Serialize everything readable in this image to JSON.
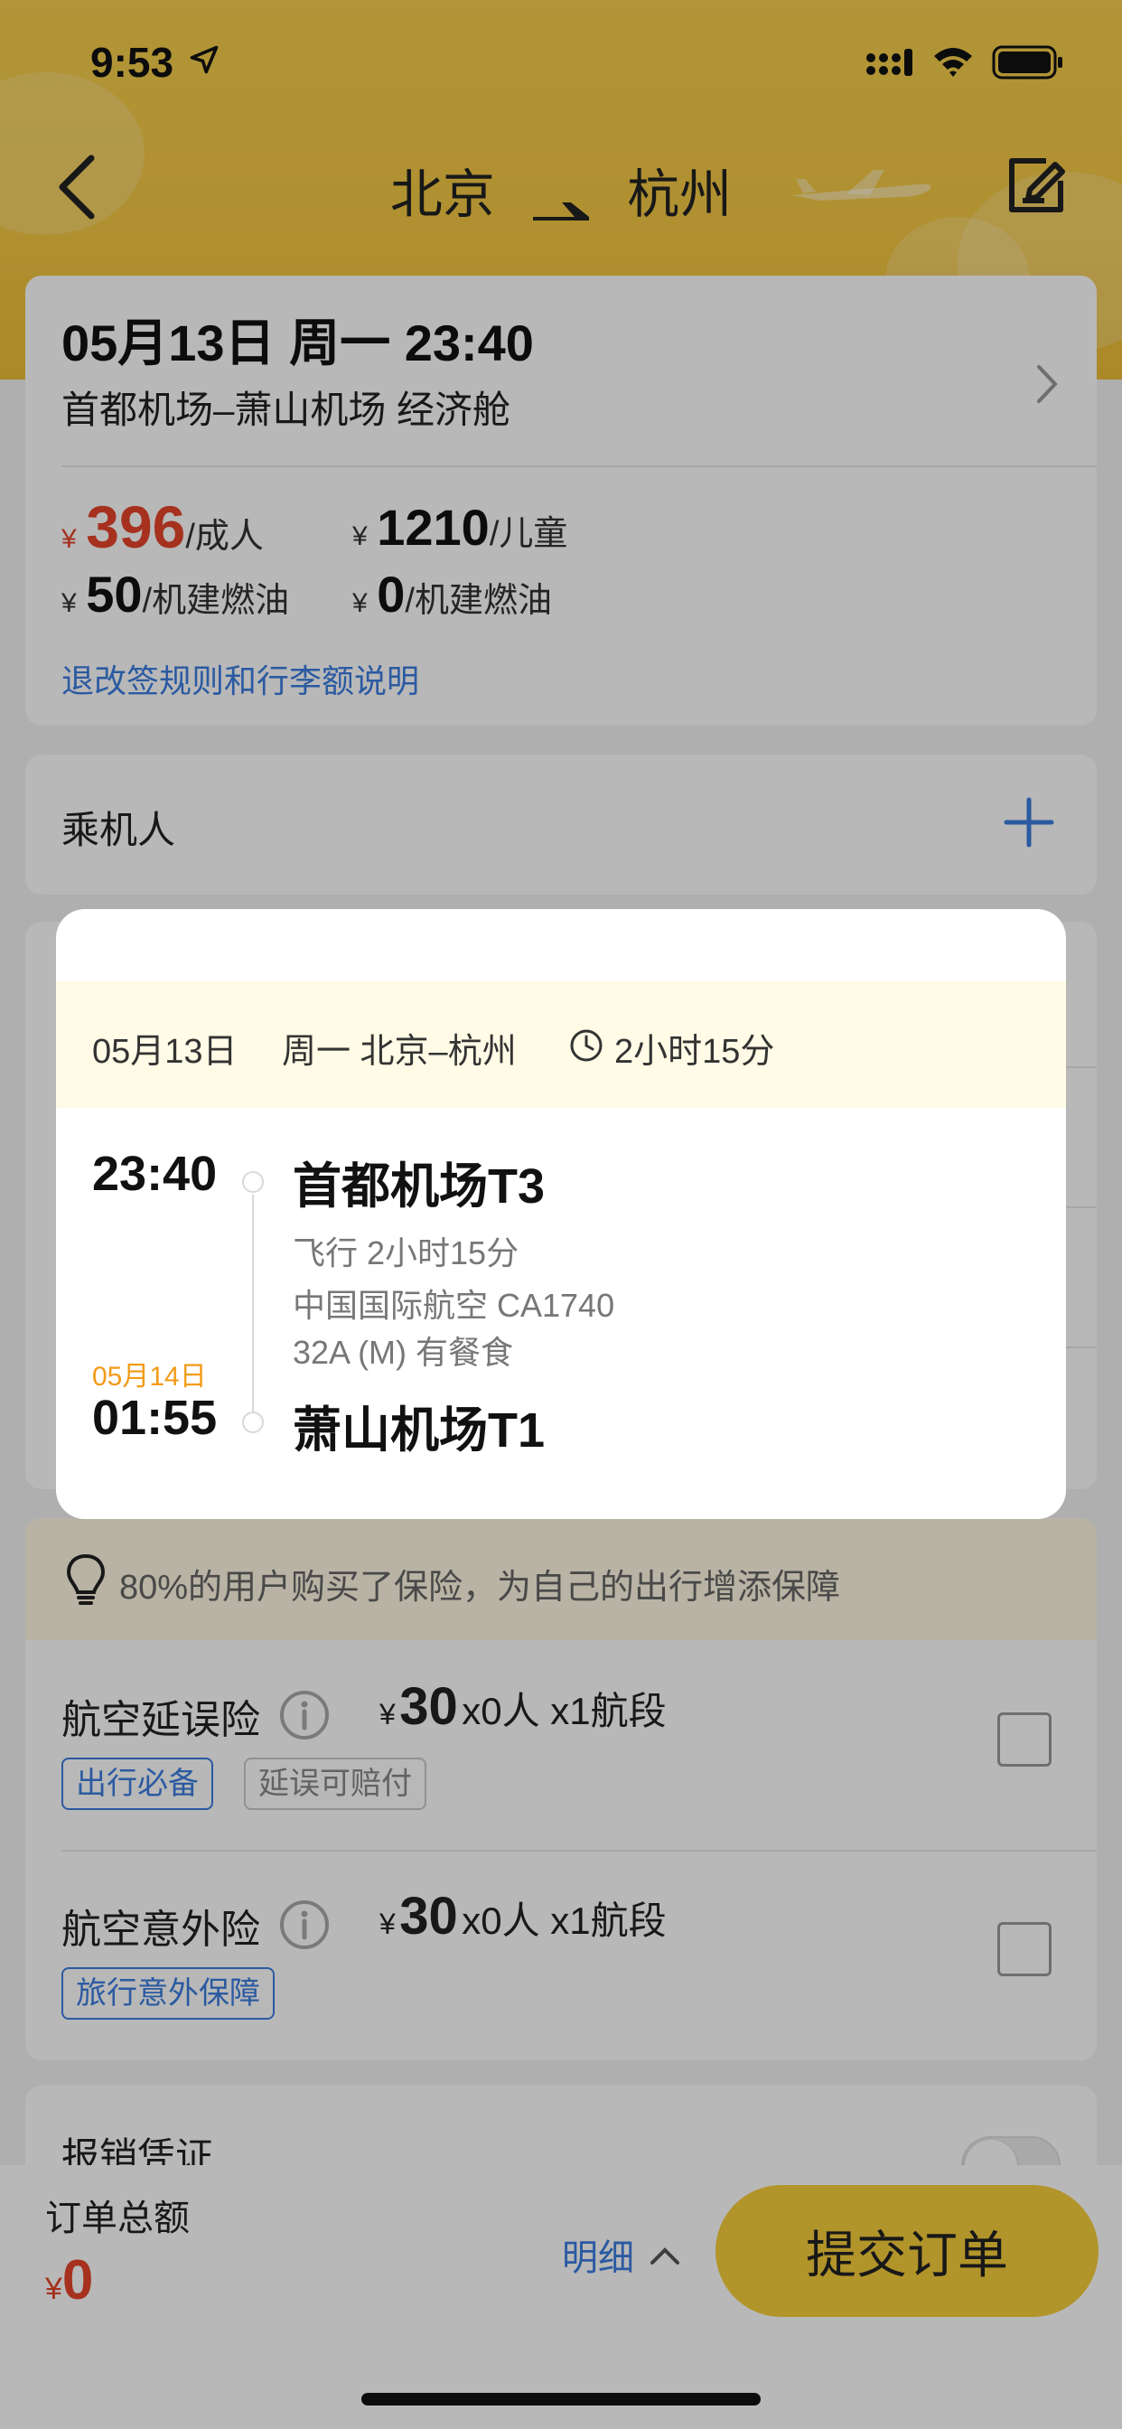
{
  "status_bar": {
    "time": "9:53"
  },
  "nav": {
    "from_city": "北京",
    "to_city": "杭州"
  },
  "flight": {
    "datetime": "05月13日 周一 23:40",
    "airports_cabin": "首都机场–萧山机场 经济舱",
    "adult_yen": "¥",
    "adult_price": "396",
    "adult_unit": "/成人",
    "child_yen": "¥",
    "child_price": "1210",
    "child_unit": "/儿童",
    "adult_tax_yen": "¥",
    "adult_tax": "50",
    "adult_tax_unit": "/机建燃油",
    "child_tax_yen": "¥",
    "child_tax": "0",
    "child_tax_unit": "/机建燃油",
    "rules_link": "退改签规则和行李额说明"
  },
  "passenger": {
    "label": "乘机人"
  },
  "insurance": {
    "tip": "80%的用户购买了保险，为自己的出行增添保障",
    "items": [
      {
        "name": "航空延误险",
        "yen": "¥",
        "price": "30",
        "multiplier": "x0人  x1航段",
        "tags": [
          "出行必备",
          "延误可赔付"
        ],
        "checked": false
      },
      {
        "name": "航空意外险",
        "yen": "¥",
        "price": "30",
        "multiplier": "x0人  x1航段",
        "tags": [
          "旅行意外保障"
        ],
        "checked": false
      }
    ]
  },
  "receipt": {
    "label": "报销凭证"
  },
  "bottom": {
    "total_label": "订单总额",
    "total_yen": "¥",
    "total_value": "0",
    "detail_label": "明细",
    "submit_label": "提交订单"
  },
  "modal": {
    "date": "05月13日",
    "weekday_route": "周一 北京–杭州",
    "duration": "2小时15分",
    "dep_time": "23:40",
    "dep_airport": "首都机场T3",
    "fly_duration": "飞行 2小时15分",
    "airline_flight": "中国国际航空 CA1740",
    "aircraft_meal": "32A (M)  有餐食",
    "arr_date": "05月14日",
    "arr_time": "01:55",
    "arr_airport": "萧山机场T1"
  },
  "colors": {
    "brand_yellow": "#f5cd3b",
    "price_red": "#e5452a",
    "link_blue": "#3c7de0",
    "arrival_date_orange": "#f29b16"
  },
  "icons": [
    "location-arrow-icon",
    "signal-icon",
    "wifi-icon",
    "battery-icon",
    "back-arrow-icon",
    "flight-arrow-icon",
    "edit-icon",
    "chevron-right-icon",
    "plus-icon",
    "lightbulb-icon",
    "info-icon",
    "clock-icon",
    "chevron-up-icon"
  ]
}
